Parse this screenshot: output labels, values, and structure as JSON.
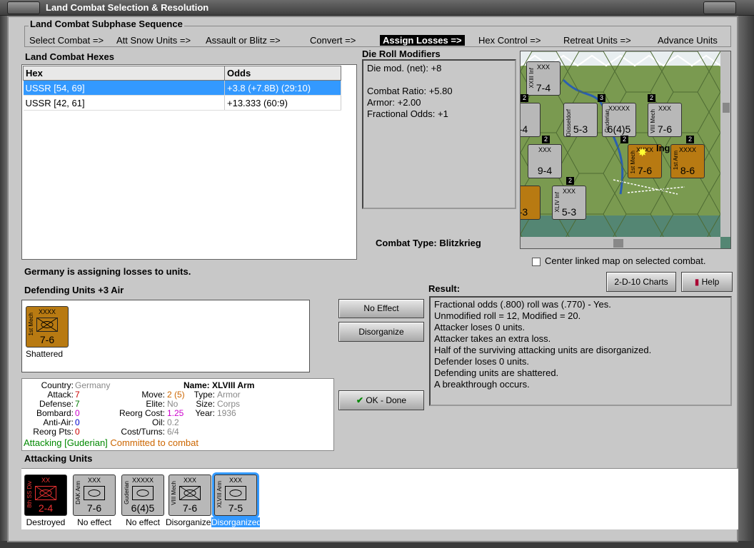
{
  "window": {
    "title": "Land Combat Selection & Resolution"
  },
  "sequence": {
    "title": "Land Combat Subphase Sequence",
    "steps": [
      "Select Combat =>",
      "Att Snow Units =>",
      "Assault or Blitz =>",
      "Convert =>",
      "Assign Losses =>",
      "Hex Control =>",
      "Retreat Units =>",
      "Advance Units"
    ],
    "active_index": 4
  },
  "hexes": {
    "title": "Land Combat Hexes",
    "col_hex": "Hex",
    "col_odds": "Odds",
    "rows": [
      {
        "hex": "USSR [54, 69]",
        "odds": "+3.8 (+7.8B) (29:10)",
        "selected": true
      },
      {
        "hex": "USSR [42, 61]",
        "odds": "+13.333 (60:9)",
        "selected": false
      }
    ]
  },
  "drm": {
    "title": "Die Roll Modifiers",
    "lines": [
      "Die mod. (net): +8",
      "",
      "Combat Ratio: +5.80",
      "Armor: +2.00",
      "Fractional Odds: +1"
    ]
  },
  "combat_type": "Combat Type:  Blitzkrieg",
  "center_map": "Center linked map on selected combat.",
  "status": "Germany is assigning losses to units.",
  "defending": {
    "title": "Defending Units +3 Air",
    "unit": {
      "size": "XXXX",
      "name": "1st Mech",
      "strength": "7-6",
      "caption": "Shattered"
    }
  },
  "buttons": {
    "no_effect": "No Effect",
    "disorganize": "Disorganize",
    "ok_done": "OK - Done",
    "charts": "2-D-10 Charts",
    "help": "Help"
  },
  "result": {
    "title": "Result:",
    "lines": [
      "Fractional odds (.800) roll was (.770)  - Yes.",
      "Unmodified roll = 12, Modified = 20.",
      "Attacker loses 0 units.",
      "Attacker takes an extra loss.",
      "Half of the surviving attacking units are disorganized.",
      "Defender loses 0 units.",
      "Defending units are shattered.",
      "A breakthrough occurs."
    ]
  },
  "info": {
    "country_l": "Country:",
    "country": "Germany",
    "attack_l": "Attack:",
    "attack": "7",
    "defense_l": "Defense:",
    "defense": "7",
    "bombard_l": "Bombard:",
    "bombard": "0",
    "antiair_l": "Anti-Air:",
    "antiair": "0",
    "reorgpts_l": "Reorg Pts:",
    "reorgpts": "0",
    "name_l": "Name:",
    "name": "XLVIII Arm",
    "move_l": "Move:",
    "move": "2 (5)",
    "type_l": "Type:",
    "type": "Armor",
    "elite_l": "Elite:",
    "elite": "No",
    "size_l": "Size:",
    "size": "Corps",
    "reorg_l": "Reorg Cost:",
    "reorg": "1.25",
    "year_l": "Year:",
    "year": "1936",
    "oil_l": "Oil:",
    "oil": "0.2",
    "cost_l": "Cost/Turns:",
    "cost": "6/4",
    "attacking": "Attacking [Guderian]",
    "committed": "Committed to combat"
  },
  "attacking": {
    "title": "Attacking Units",
    "units": [
      {
        "size": "XX",
        "name": "8th SS Div",
        "strength": "2-4",
        "caption": "Destroyed"
      },
      {
        "size": "XXX",
        "name": "DAK Arm",
        "strength": "7-6",
        "caption": "No effect"
      },
      {
        "size": "XXXXX",
        "name": "Guderian",
        "strength": "6(4)5",
        "caption": "No effect"
      },
      {
        "size": "XXX",
        "name": "VIII Mech",
        "strength": "7-6",
        "caption": "Disorganized"
      },
      {
        "size": "XXX",
        "name": "XLVIII Arm",
        "strength": "7-5",
        "caption": "Disorganized"
      }
    ]
  },
  "map": {
    "units": [
      {
        "name": "XXIII Inf",
        "size": "XXX",
        "strength": "7-4"
      },
      {
        "name": "Düsseldorf",
        "size": "",
        "strength": "5-3"
      },
      {
        "name": "Guderian",
        "size": "XXXXX",
        "strength": "6(4)5"
      },
      {
        "name": "VIII Mech",
        "size": "XXX",
        "strength": "7-6"
      },
      {
        "name": "",
        "size": "XXX",
        "strength": "9-4"
      },
      {
        "name": "1st Mech",
        "size": "XXXX",
        "strength": "7-6"
      },
      {
        "name": "1st Arm",
        "size": "XXXX",
        "strength": "8-6"
      },
      {
        "name": "XLIV Inf",
        "size": "XXX",
        "strength": "5-3"
      },
      {
        "name": "",
        "size": "",
        "strength": "-4"
      },
      {
        "name": "",
        "size": "",
        "strength": "-3"
      }
    ],
    "stack_labels": [
      "2",
      "3",
      "2",
      "2",
      "2",
      "2",
      "2"
    ],
    "city_label": "Ing"
  },
  "colors": {
    "selection": "#3399ff",
    "german_tan": "#b87a12",
    "gray_counter": "#b8b8b8",
    "destroyed_bg": "#000000"
  }
}
